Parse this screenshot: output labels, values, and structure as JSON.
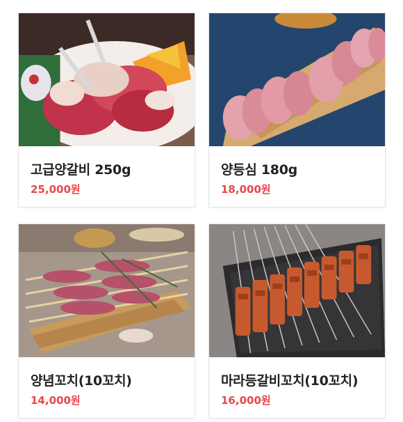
{
  "menu": {
    "items": [
      {
        "name": "고급양갈비 250g",
        "price": "25,000원",
        "image": "lamb-ribs-plate-photo"
      },
      {
        "name": "양등심 180g",
        "price": "18,000원",
        "image": "lamb-loin-board-photo"
      },
      {
        "name": "양념꼬치(10꼬치)",
        "price": "14,000원",
        "image": "seasoned-skewers-board-photo"
      },
      {
        "name": "마라등갈비꼬치(10꼬치)",
        "price": "16,000원",
        "image": "mala-rib-skewers-photo"
      }
    ]
  },
  "colors": {
    "price": "#e8474c",
    "name": "#222222",
    "card_border": "#e6e6e6"
  }
}
